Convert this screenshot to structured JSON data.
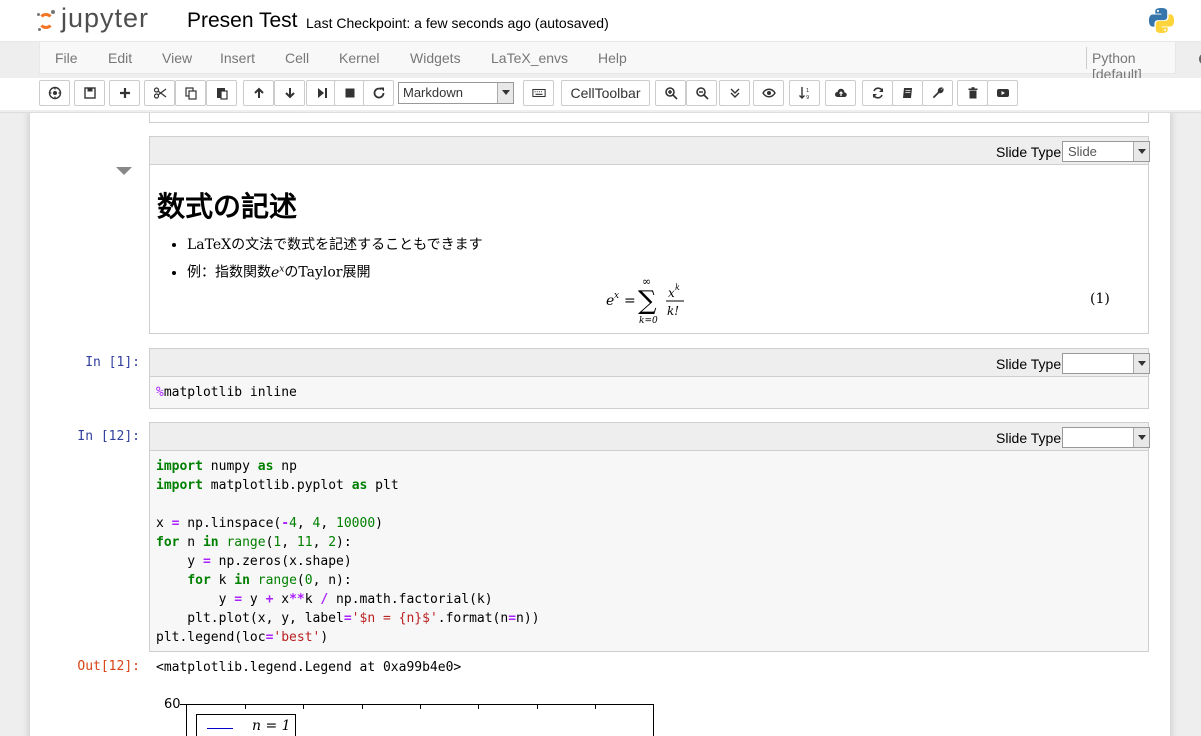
{
  "header": {
    "logo_text": "jupyter",
    "notebook_name": "Presen Test",
    "checkpoint": "Last Checkpoint: a few seconds ago (autosaved)"
  },
  "menu": {
    "items": [
      "File",
      "Edit",
      "View",
      "Insert",
      "Cell",
      "Kernel",
      "Widgets",
      "LaTeX_envs",
      "Help"
    ],
    "kernel": "Python [default]"
  },
  "toolbar": {
    "cell_type": "Markdown",
    "celltoolbar_label": "CellToolbar"
  },
  "cells": [
    {
      "type": "markdown",
      "slide_type_label": "Slide Type",
      "slide_type_value": "Slide",
      "heading": "数式の記述",
      "bullets": [
        "LaTeXの文法で数式を記述することもできます",
        "例：指数関数"
      ],
      "bullet2_suffix": "のTaylor展開",
      "eq_number": "(1)"
    },
    {
      "type": "code",
      "prompt": "In [1]:",
      "slide_type_label": "Slide Type",
      "slide_type_value": ""
    },
    {
      "type": "code",
      "prompt": "In [12]:",
      "slide_type_label": "Slide Type",
      "slide_type_value": "",
      "out_prompt": "Out[12]:",
      "output_text": "<matplotlib.legend.Legend at 0xa99b4e0>",
      "plot_ytick_top": "60",
      "plot_legend_first": "n = 1"
    }
  ],
  "colors": {
    "in_prompt": "#303f9f",
    "out_prompt": "#d84315",
    "keyword": "#008000",
    "operator": "#aa22ff",
    "string": "#ba2121",
    "logo_orange": "#f37626"
  }
}
